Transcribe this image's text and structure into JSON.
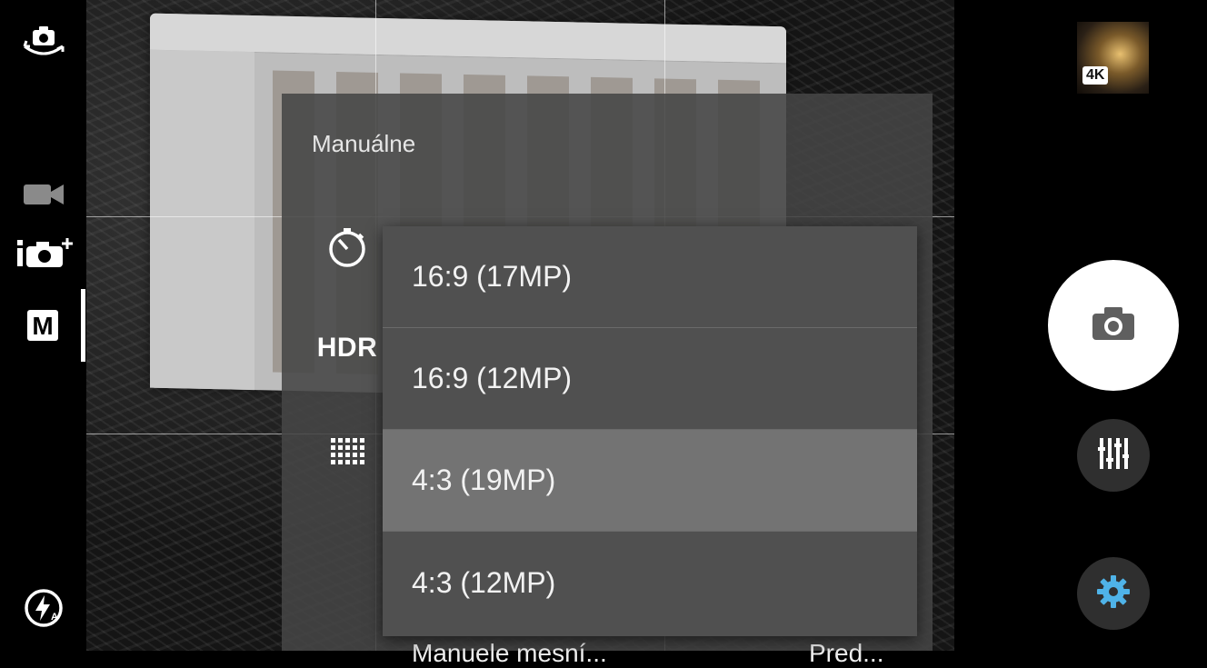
{
  "panel": {
    "title": "Manuálne",
    "hdr_label": "HDR",
    "bottom_labels": [
      "Manuele mesní...",
      "Pred..."
    ]
  },
  "resolution_menu": {
    "options": [
      {
        "label": "16:9 (17MP)",
        "selected": false
      },
      {
        "label": "16:9 (12MP)",
        "selected": false
      },
      {
        "label": "4:3 (19MP)",
        "selected": true
      },
      {
        "label": "4:3 (12MP)",
        "selected": false
      }
    ]
  },
  "left_rail": {
    "icons": [
      "switch-camera-icon",
      "video-mode-icon",
      "superior-auto-icon",
      "manual-mode-icon",
      "flash-auto-icon"
    ],
    "manual_label": "M",
    "active_mode": "manual"
  },
  "right_rail": {
    "thumbnail_badge": "4K",
    "icons": [
      "camera-icon",
      "manual-settings-icon",
      "gear-icon"
    ],
    "gear_color": "#4fb3e8"
  }
}
